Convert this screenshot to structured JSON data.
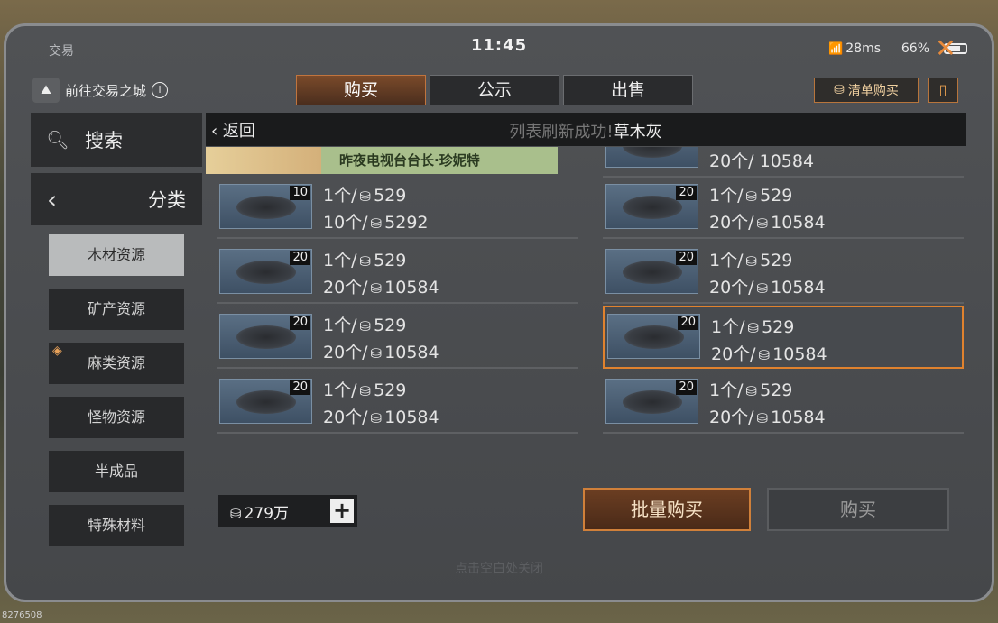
{
  "status": {
    "app_name": "交易",
    "time": "11:45",
    "ping": "28ms",
    "battery": "66%"
  },
  "top": {
    "city_link": "前往交易之城",
    "list_buy": "清单购买"
  },
  "tabs": [
    {
      "label": "购买",
      "active": true
    },
    {
      "label": "公示",
      "active": false
    },
    {
      "label": "出售",
      "active": false
    }
  ],
  "sidebar": {
    "search": "搜索",
    "category": "分类",
    "items": [
      {
        "label": "木材资源",
        "active": true
      },
      {
        "label": "矿产资源"
      },
      {
        "label": "麻类资源",
        "marked": true
      },
      {
        "label": "怪物资源"
      },
      {
        "label": "半成品"
      },
      {
        "label": "特殊材料"
      }
    ]
  },
  "header": {
    "back": "返回",
    "toast": "列表刷新成功!",
    "item_name": "草木灰"
  },
  "banner": {
    "text": "昨夜电视台台长·珍妮特"
  },
  "listings": {
    "partial_top_right": {
      "total": "20个/ 10584"
    },
    "left": [
      {
        "qty": "10",
        "unit": "1个/",
        "unit_price": "529",
        "bulk": "10个/",
        "bulk_price": "5292"
      },
      {
        "qty": "20",
        "unit": "1个/",
        "unit_price": "529",
        "bulk": "20个/",
        "bulk_price": "10584"
      },
      {
        "qty": "20",
        "unit": "1个/",
        "unit_price": "529",
        "bulk": "20个/",
        "bulk_price": "10584"
      },
      {
        "qty": "20",
        "unit": "1个/",
        "unit_price": "529",
        "bulk": "20个/",
        "bulk_price": "10584"
      }
    ],
    "right": [
      {
        "qty": "20",
        "unit": "1个/",
        "unit_price": "529",
        "bulk": "20个/",
        "bulk_price": "10584"
      },
      {
        "qty": "20",
        "unit": "1个/",
        "unit_price": "529",
        "bulk": "20个/",
        "bulk_price": "10584"
      },
      {
        "qty": "20",
        "unit": "1个/",
        "unit_price": "529",
        "bulk": "20个/",
        "bulk_price": "10584",
        "selected": true
      },
      {
        "qty": "20",
        "unit": "1个/",
        "unit_price": "529",
        "bulk": "20个/",
        "bulk_price": "10584"
      }
    ]
  },
  "wallet": {
    "amount": "279万"
  },
  "actions": {
    "batch_buy": "批量购买",
    "buy": "购买"
  },
  "hint": "点击空白处关闭",
  "session_id": "8276508",
  "colors": {
    "accent": "#e0822e",
    "panel": "#45474a"
  }
}
